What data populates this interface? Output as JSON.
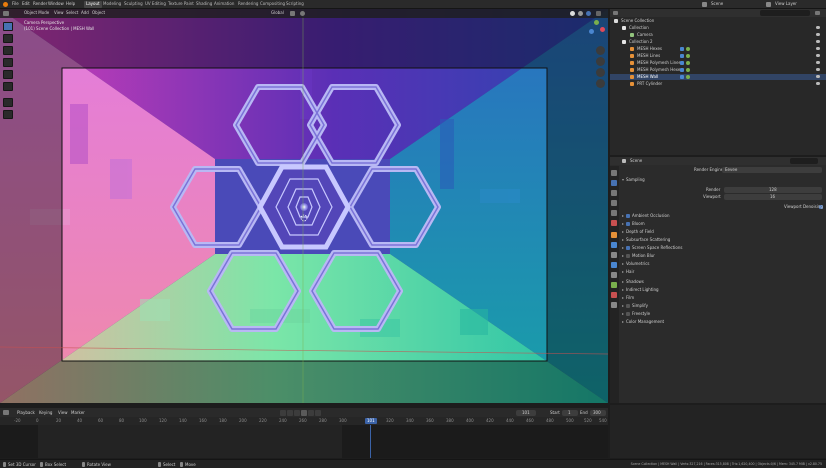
{
  "menu": {
    "items": [
      "File",
      "Edit",
      "Render",
      "Window",
      "Help"
    ],
    "workspaces": [
      "Layout",
      "Modeling",
      "Sculpting",
      "UV Editing",
      "Texture Paint",
      "Shading",
      "Animation",
      "Rendering",
      "Compositing",
      "Scripting"
    ],
    "active_workspace": "Layout",
    "scene_name": "Scene",
    "view_layer": "View Layer"
  },
  "viewport": {
    "mode": "Object Mode",
    "menus": [
      "View",
      "Select",
      "Add",
      "Object"
    ],
    "transform": "Global",
    "overlay_title": "Camera Perspective",
    "overlay_subtitle": "(101) Scene Collection | MESH Wall"
  },
  "outliner": {
    "title": "Scene Collection",
    "rows": [
      {
        "label": "Collection",
        "depth": 1,
        "icon_color": "#e6e6e6"
      },
      {
        "label": "Camera",
        "depth": 2,
        "icon_color": "#93c47d"
      },
      {
        "label": "Collection 2",
        "depth": 1,
        "icon_color": "#e6e6e6"
      },
      {
        "label": "MESH Hexes",
        "depth": 2,
        "icon_color": "#e69138"
      },
      {
        "label": "MESH Lines",
        "depth": 2,
        "icon_color": "#e69138"
      },
      {
        "label": "MESH Polymesh Lines",
        "depth": 2,
        "icon_color": "#e69138"
      },
      {
        "label": "MESH Polymesh Hexes",
        "depth": 2,
        "icon_color": "#e69138"
      },
      {
        "label": "MESH Wall",
        "depth": 2,
        "icon_color": "#e69138",
        "selected": true
      },
      {
        "label": "PRT Cylinder",
        "depth": 2,
        "icon_color": "#e69138"
      }
    ]
  },
  "properties": {
    "title": "Scene",
    "render_engine_label": "Render Engine",
    "render_engine": "Eevee",
    "sampling_label": "Sampling",
    "render_label": "Render",
    "render_samples": "128",
    "viewport_label": "Viewport",
    "viewport_samples": "16",
    "viewport_denoising": "Viewport Denoising",
    "panels": [
      {
        "label": "Ambient Occlusion",
        "check": true,
        "on": true
      },
      {
        "label": "Bloom",
        "check": true,
        "on": true
      },
      {
        "label": "Depth of Field",
        "check": false
      },
      {
        "label": "Subsurface Scattering",
        "check": false
      },
      {
        "label": "Screen Space Reflections",
        "check": true,
        "on": true
      },
      {
        "label": "Motion Blur",
        "check": true,
        "on": false
      },
      {
        "label": "Volumetrics",
        "check": false
      },
      {
        "label": "Hair",
        "check": false
      },
      {
        "label": "Shadows",
        "check": false
      },
      {
        "label": "Indirect Lighting",
        "check": false
      },
      {
        "label": "Film",
        "check": false
      },
      {
        "label": "Simplify",
        "check": true,
        "on": false
      },
      {
        "label": "Freestyle",
        "check": true,
        "on": false
      },
      {
        "label": "Color Management",
        "check": false
      }
    ]
  },
  "timeline": {
    "menus": [
      "Playback",
      "Keying",
      "View",
      "Marker"
    ],
    "current_frame": "101",
    "start_label": "Start",
    "start": "1",
    "end_label": "End",
    "end": "300",
    "ticks": [
      "-20",
      "0",
      "20",
      "40",
      "60",
      "80",
      "100",
      "120",
      "140",
      "160",
      "180",
      "200",
      "220",
      "240",
      "260",
      "280",
      "300",
      "320",
      "340",
      "360",
      "380",
      "400",
      "420",
      "440",
      "460",
      "480",
      "500",
      "520",
      "540"
    ]
  },
  "status": {
    "left": [
      "Set 3D Cursor",
      "Box Select",
      "Rotate View",
      "Select",
      "Move"
    ],
    "right": "Scene Collection | MESH Wall | Verts:327,216 | Faces:315,808 | Tris:1,620,400 | Objects:0/6 | Mem: 345.7 MiB | v2.80.75"
  },
  "colors": {
    "accent": "#4772b3",
    "frame_marker": "#3b63a8",
    "selected_row": "#314465"
  }
}
